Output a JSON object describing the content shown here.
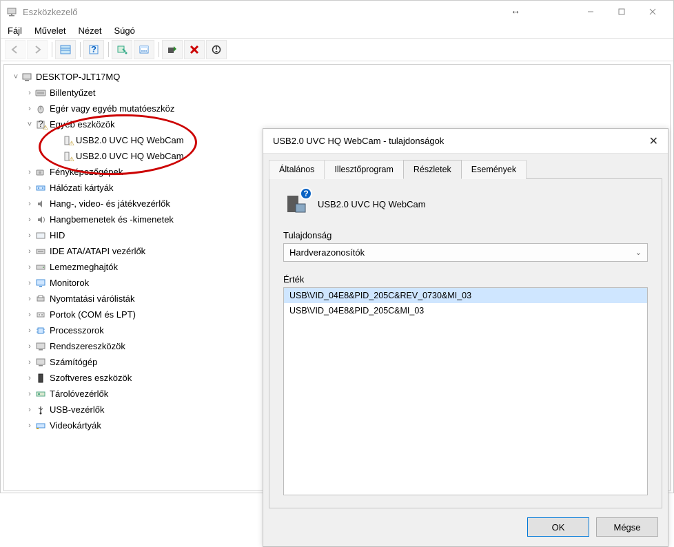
{
  "window": {
    "title": "Eszközkezelő"
  },
  "menubar": {
    "items": [
      "Fájl",
      "Művelet",
      "Nézet",
      "Súgó"
    ]
  },
  "tree": {
    "root": "DESKTOP-JLT17MQ",
    "nodes": [
      {
        "label": "Billentyűzet"
      },
      {
        "label": "Egér vagy egyéb mutatóeszköz"
      },
      {
        "label": "Egyéb eszközök",
        "children": [
          {
            "label": "USB2.0 UVC HQ WebCam"
          },
          {
            "label": "USB2.0 UVC HQ WebCam"
          }
        ]
      },
      {
        "label": "Fényképezőgépek"
      },
      {
        "label": "Hálózati kártyák"
      },
      {
        "label": "Hang-, video- és játékvezérlők"
      },
      {
        "label": "Hangbemenetek és -kimenetek"
      },
      {
        "label": "HID"
      },
      {
        "label": "IDE ATA/ATAPI vezérlők"
      },
      {
        "label": "Lemezmeghajtók"
      },
      {
        "label": "Monitorok"
      },
      {
        "label": "Nyomtatási várólisták"
      },
      {
        "label": "Portok (COM és LPT)"
      },
      {
        "label": "Processzorok"
      },
      {
        "label": "Rendszereszközök"
      },
      {
        "label": "Számítógép"
      },
      {
        "label": "Szoftveres eszközök"
      },
      {
        "label": "Tárolóvezérlők"
      },
      {
        "label": "USB-vezérlők"
      },
      {
        "label": "Videokártyák"
      }
    ]
  },
  "dialog": {
    "title": "USB2.0 UVC HQ WebCam - tulajdonságok",
    "tabs": [
      "Általános",
      "Illesztőprogram",
      "Részletek",
      "Események"
    ],
    "active_tab": "Részletek",
    "device_name": "USB2.0 UVC HQ WebCam",
    "property_label": "Tulajdonság",
    "property_value": "Hardverazonosítók",
    "value_label": "Érték",
    "values": [
      "USB\\VID_04E8&PID_205C&REV_0730&MI_03",
      "USB\\VID_04E8&PID_205C&MI_03"
    ],
    "ok": "OK",
    "cancel": "Mégse"
  }
}
